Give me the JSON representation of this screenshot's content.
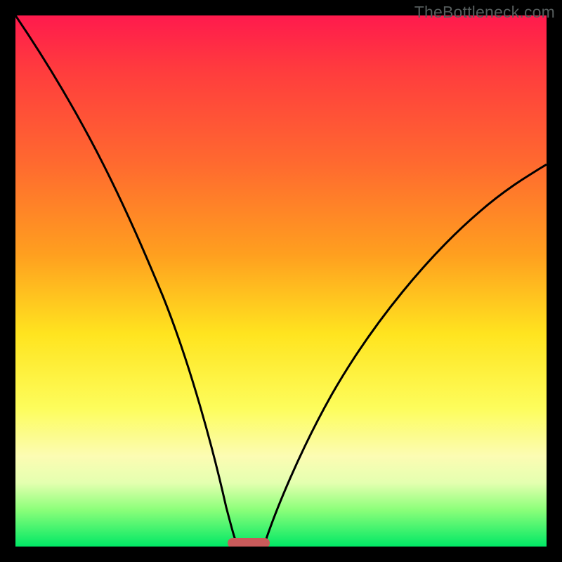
{
  "watermark": "TheBottleneck.com",
  "chart_data": {
    "type": "line",
    "title": "",
    "xlabel": "",
    "ylabel": "",
    "xlim": [
      0,
      1
    ],
    "ylim": [
      0,
      1
    ],
    "series": [
      {
        "name": "left-curve",
        "x": [
          0.0,
          0.05,
          0.1,
          0.15,
          0.2,
          0.25,
          0.3,
          0.35,
          0.39,
          0.41
        ],
        "y": [
          1.0,
          0.88,
          0.75,
          0.62,
          0.49,
          0.36,
          0.24,
          0.13,
          0.04,
          0.0
        ]
      },
      {
        "name": "right-curve",
        "x": [
          0.47,
          0.5,
          0.56,
          0.62,
          0.7,
          0.78,
          0.86,
          0.94,
          1.0
        ],
        "y": [
          0.0,
          0.06,
          0.17,
          0.28,
          0.4,
          0.51,
          0.6,
          0.67,
          0.72
        ]
      }
    ],
    "marker": {
      "name": "bottleneck-marker",
      "x_center": 0.438,
      "width": 0.08,
      "y": 0.0,
      "color": "#c95a5a"
    },
    "gradient_stops": [
      {
        "pos": 0.0,
        "color": "#ff1a4d"
      },
      {
        "pos": 0.45,
        "color": "#ff9f1f"
      },
      {
        "pos": 0.74,
        "color": "#fdfd5c"
      },
      {
        "pos": 1.0,
        "color": "#00e865"
      }
    ]
  }
}
